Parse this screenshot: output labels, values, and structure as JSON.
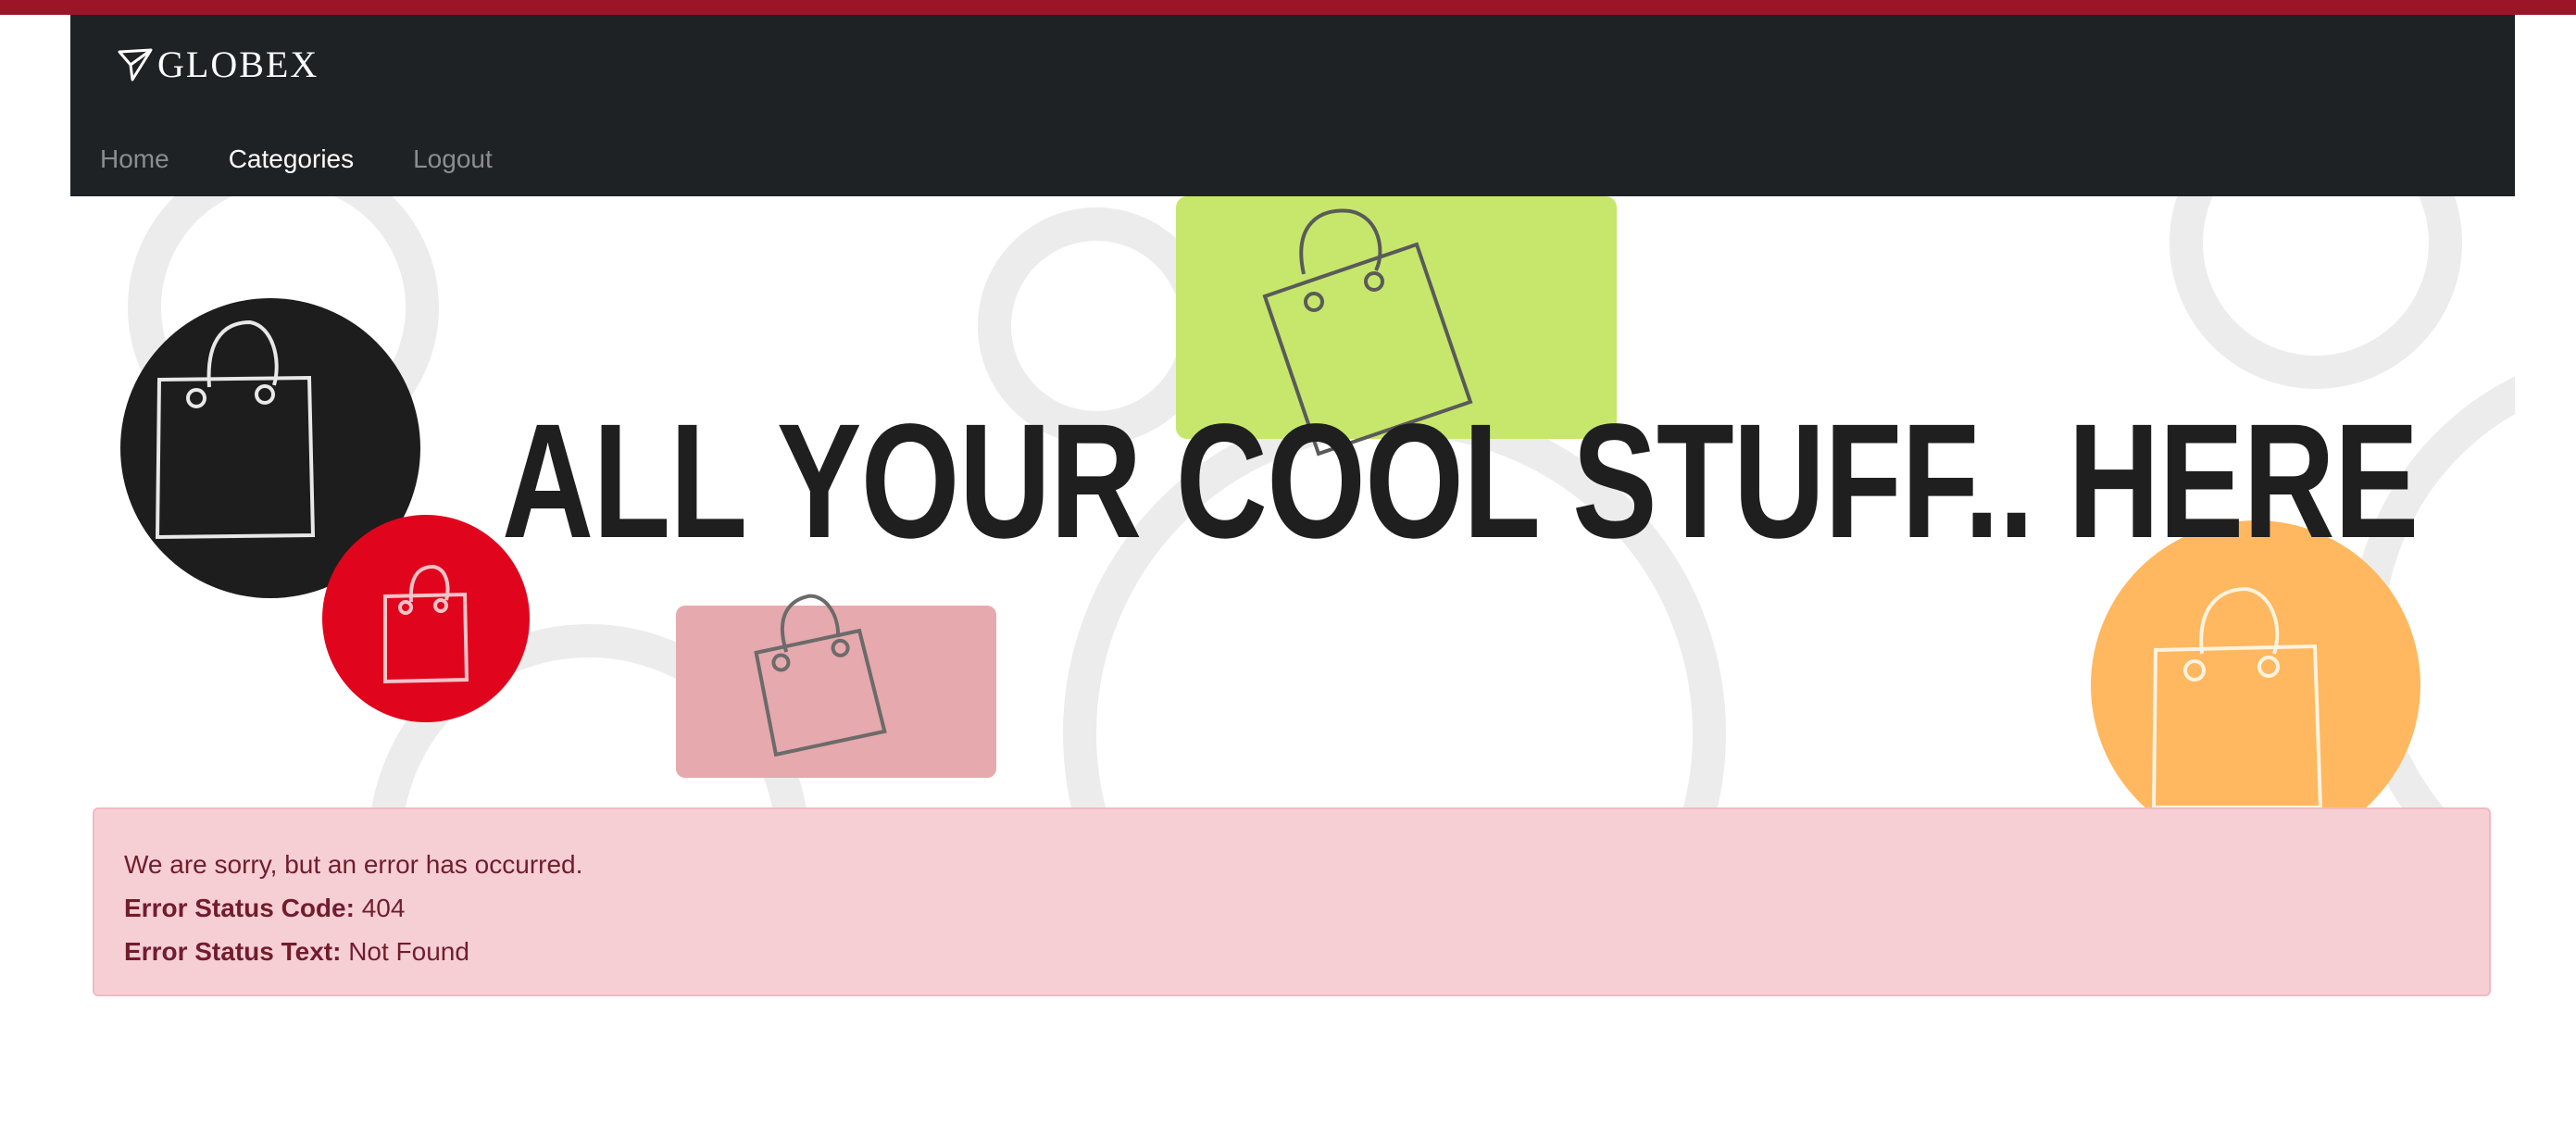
{
  "brand": {
    "name": "GLOBEX",
    "icon": "paper-plane-icon"
  },
  "nav": {
    "items": [
      {
        "label": "Home",
        "active": false
      },
      {
        "label": "Categories",
        "active": true
      },
      {
        "label": "Logout",
        "active": false
      }
    ]
  },
  "banner": {
    "headline": "ALL YOUR COOL STUFF.. HERE",
    "icons": [
      "shopping-bag-icon"
    ]
  },
  "error": {
    "message": "We are sorry, but an error has occurred.",
    "status_code_label": "Error Status Code:",
    "status_code_value": "404",
    "status_text_label": "Error Status Text:",
    "status_text_value": "Not Found"
  },
  "colors": {
    "top_strip": "#9b1428",
    "navbar": "#1f2225",
    "alert_bg": "#f6cfd5",
    "alert_text": "#721c2c",
    "accent_green": "#c6e76b",
    "accent_red": "#e0051d",
    "accent_pink": "#e6a9ad",
    "accent_orange": "#ffb860"
  }
}
